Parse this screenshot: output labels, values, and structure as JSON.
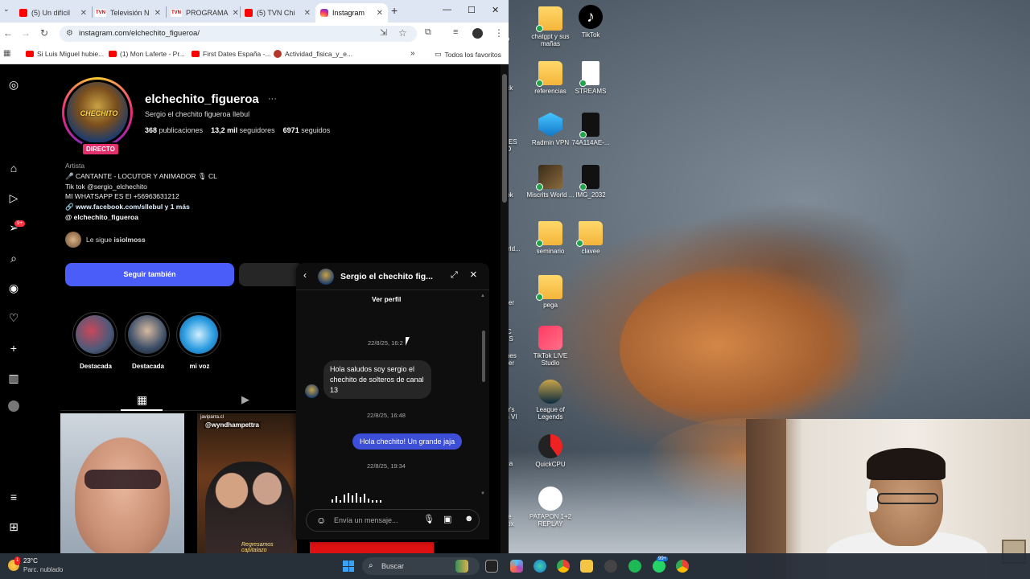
{
  "browser": {
    "tabs": [
      {
        "label": "(5) Un difícil",
        "icon": "youtube-icon"
      },
      {
        "label": "Televisión N",
        "icon": "tvn-icon"
      },
      {
        "label": "PROGRAMA",
        "icon": "tvn-icon"
      },
      {
        "label": "(5) TVN Chi",
        "icon": "youtube-icon"
      },
      {
        "label": "Instagram",
        "icon": "instagram-icon"
      }
    ],
    "url": "instagram.com/elchechito_figueroa/",
    "bookmarks": [
      {
        "label": "Si Luis Miguel hubie...",
        "icon": "youtube-icon"
      },
      {
        "label": "(1) Mon Laferte - Pr...",
        "icon": "youtube-icon"
      },
      {
        "label": "First Dates España -...",
        "icon": "youtube-icon"
      },
      {
        "label": "Actividad_fisica_y_e...",
        "icon": "doc-icon"
      }
    ],
    "all_favorites": "Todos los favoritos",
    "tvn_fav_text": "TVN"
  },
  "profile": {
    "username": "elchechito_figueroa",
    "full_name": "Sergio el chechito figueroa llebul",
    "stats": {
      "posts": "368",
      "posts_label": "publicaciones",
      "followers": "13,2 mil",
      "followers_label": "seguidores",
      "following": "6971",
      "following_label": "seguidos"
    },
    "live_badge": "DIRECTO",
    "avatar_logo": "CHECHITO",
    "category": "Artista",
    "bio_lines": [
      "🎤 CANTANTE - LOCUTOR Y ANIMADOR 🎙 CL",
      "Tik tok @sergio_elchechito",
      "MI WHATSAPP ES El +56963631212"
    ],
    "link": "🔗 www.facebook.com/sllebul y 1 más",
    "threads": "@ elchechito_figueroa",
    "followed_by_prefix": "Le sigue",
    "followed_by_user": "isiolmoss",
    "follow_button": "Seguir también",
    "highlights": [
      {
        "label": "Destacada"
      },
      {
        "label": "Destacada"
      },
      {
        "label": "mi voz"
      }
    ],
    "post2_user": "javiparra.cl",
    "post2_caption": "@wyndhampettra",
    "post2_footer": "Regresamos capitalazo"
  },
  "dm": {
    "title": "Sergio el chechito fig...",
    "view_profile": "Ver perfil",
    "timestamps": [
      "22/8/25, 16:2",
      "22/8/25, 16:48",
      "22/8/25, 19:34"
    ],
    "incoming_message": "Hola saludos soy sergio el chechito de solteros de canal 13",
    "outgoing_message": "Hola chechito! Un grande jaja",
    "input_placeholder": "Envía un mensaje..."
  },
  "desktop_icons": [
    {
      "label": "chatgpt y sus mañas",
      "kind": "folder"
    },
    {
      "label": "TikTok",
      "kind": "tiktok"
    },
    {
      "label": "referencias",
      "kind": "folder"
    },
    {
      "label": "STREAMS",
      "kind": "file"
    },
    {
      "label": "Radmin VPN",
      "kind": "radmin"
    },
    {
      "label": "74A114AE-...",
      "kind": "dark"
    },
    {
      "label": "Miscrits World ...",
      "kind": "game"
    },
    {
      "label": "IMG_2032",
      "kind": "dark"
    },
    {
      "label": "seminario",
      "kind": "folder"
    },
    {
      "label": "clavee",
      "kind": "folder"
    },
    {
      "label": "pega",
      "kind": "folder"
    },
    {
      "label": "TikTok LIVE Studio",
      "kind": "tiktoklive"
    },
    {
      "label": "League of Legends",
      "kind": "lol"
    },
    {
      "label": "QuickCPU",
      "kind": "quick"
    },
    {
      "label": "PATAPON 1+2 REPLAY",
      "kind": "patapon"
    }
  ],
  "desktop_cut_labels": [
    "ito",
    "ack",
    "ORTES GO",
    "book",
    "World...",
    "ncher",
    "PIC MES",
    "Games ncher",
    "lefer's ation VI",
    "ctica",
    "ube ldbox"
  ],
  "taskbar": {
    "temperature": "23°C",
    "weather": "Parc. nublado",
    "weather_alert": "1",
    "search_placeholder": "Buscar",
    "whatsapp_badge": "99+"
  },
  "colors": {
    "follow_button": "#4a5df9",
    "outgoing_bubble": "#3d4fd6",
    "live_badge": "#e1306c"
  }
}
